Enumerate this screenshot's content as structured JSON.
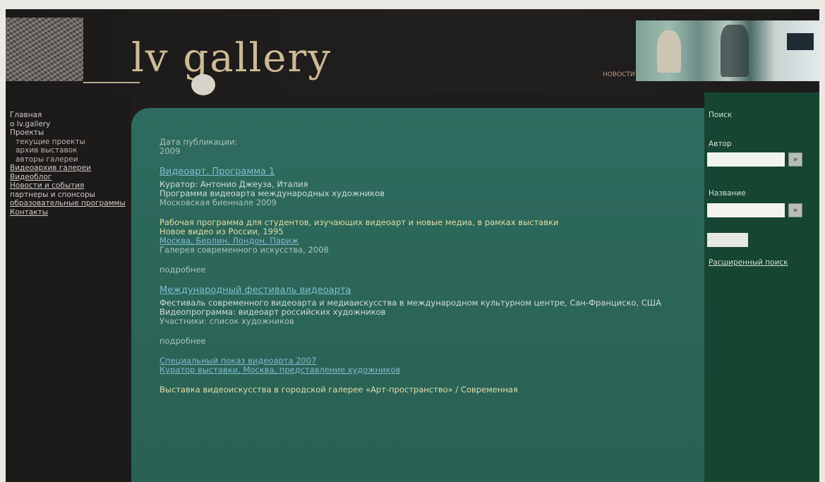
{
  "header": {
    "site_title": "lv gallery",
    "caption": "НОВОСТИ"
  },
  "left_nav": {
    "items": [
      {
        "label": "Главная",
        "level": 0
      },
      {
        "label": "о lv.gallery",
        "level": 0
      },
      {
        "label": "Проекты",
        "level": 0
      },
      {
        "label": "текущие проекты",
        "level": 1
      },
      {
        "label": "архив выставок",
        "level": 1
      },
      {
        "label": "авторы галереи",
        "level": 1
      },
      {
        "label": "Видеоархив галереи",
        "level": 0,
        "underline": true
      },
      {
        "label": "Видеоблог",
        "level": 0,
        "underline": true
      },
      {
        "label": "Новости и события",
        "level": 0,
        "underline": true
      },
      {
        "label": "партнеры и спонсоры",
        "level": 0
      },
      {
        "label": "образовательные программы",
        "level": 0,
        "underline": true
      },
      {
        "label": "Контакты",
        "level": 0,
        "underline": true
      }
    ]
  },
  "content": {
    "blocks": [
      {
        "lines": [
          {
            "text": "Дата публикации:",
            "style": "dim"
          },
          {
            "text": "2009",
            "style": "dim"
          }
        ]
      },
      {
        "heading": "Видеоарт. Программа 1",
        "lines": [
          {
            "text": "Куратор: Антонио Джеуза, Италия",
            "style": ""
          },
          {
            "text": "Программа видеоарта международных художников",
            "style": ""
          },
          {
            "text": "Московская биеннале 2009",
            "style": "dim"
          }
        ]
      },
      {
        "lines": [
          {
            "text": "Рабочая программа для студентов, изучающих видеоарт и новые медиа, в рамках выставки",
            "style": "yellow"
          },
          {
            "text": "Новое видео из России, 1995",
            "style": "yellow"
          },
          {
            "text": "Москва, Берлин, Лондон, Париж",
            "style": "link"
          },
          {
            "text": "Галерея современного искусства, 2008",
            "style": "dim"
          }
        ]
      },
      {
        "lines": [
          {
            "text": "подробнее",
            "style": "dim"
          }
        ]
      },
      {
        "heading": "Международный фестиваль видеоарта",
        "lines": [
          {
            "text": "Фестиваль современного видеоарта и медиаискусства в международном культурном центре, Сан-Франциско, США",
            "style": ""
          },
          {
            "text": "Видеопрограмма: видеоарт российских художников",
            "style": ""
          },
          {
            "text": "Участники: список художников",
            "style": "dim"
          }
        ]
      },
      {
        "lines": [
          {
            "text": "подробнее",
            "style": "dim"
          }
        ]
      },
      {
        "lines": [
          {
            "text": "Специальный показ видеоарта 2007",
            "style": "link"
          },
          {
            "text": "Куратор выставки, Москва, представление художников",
            "style": "link"
          }
        ]
      },
      {
        "lines": [
          {
            "text": "Выставка видеоискусства в городской галерее «Арт-пространство» / Современная",
            "style": "yellow"
          }
        ]
      }
    ]
  },
  "right_col": {
    "title": "Поиск",
    "label1": "Автор",
    "input1_placeholder": "",
    "label2": "Название",
    "input2_placeholder": "",
    "link": "Расширенный поиск"
  }
}
